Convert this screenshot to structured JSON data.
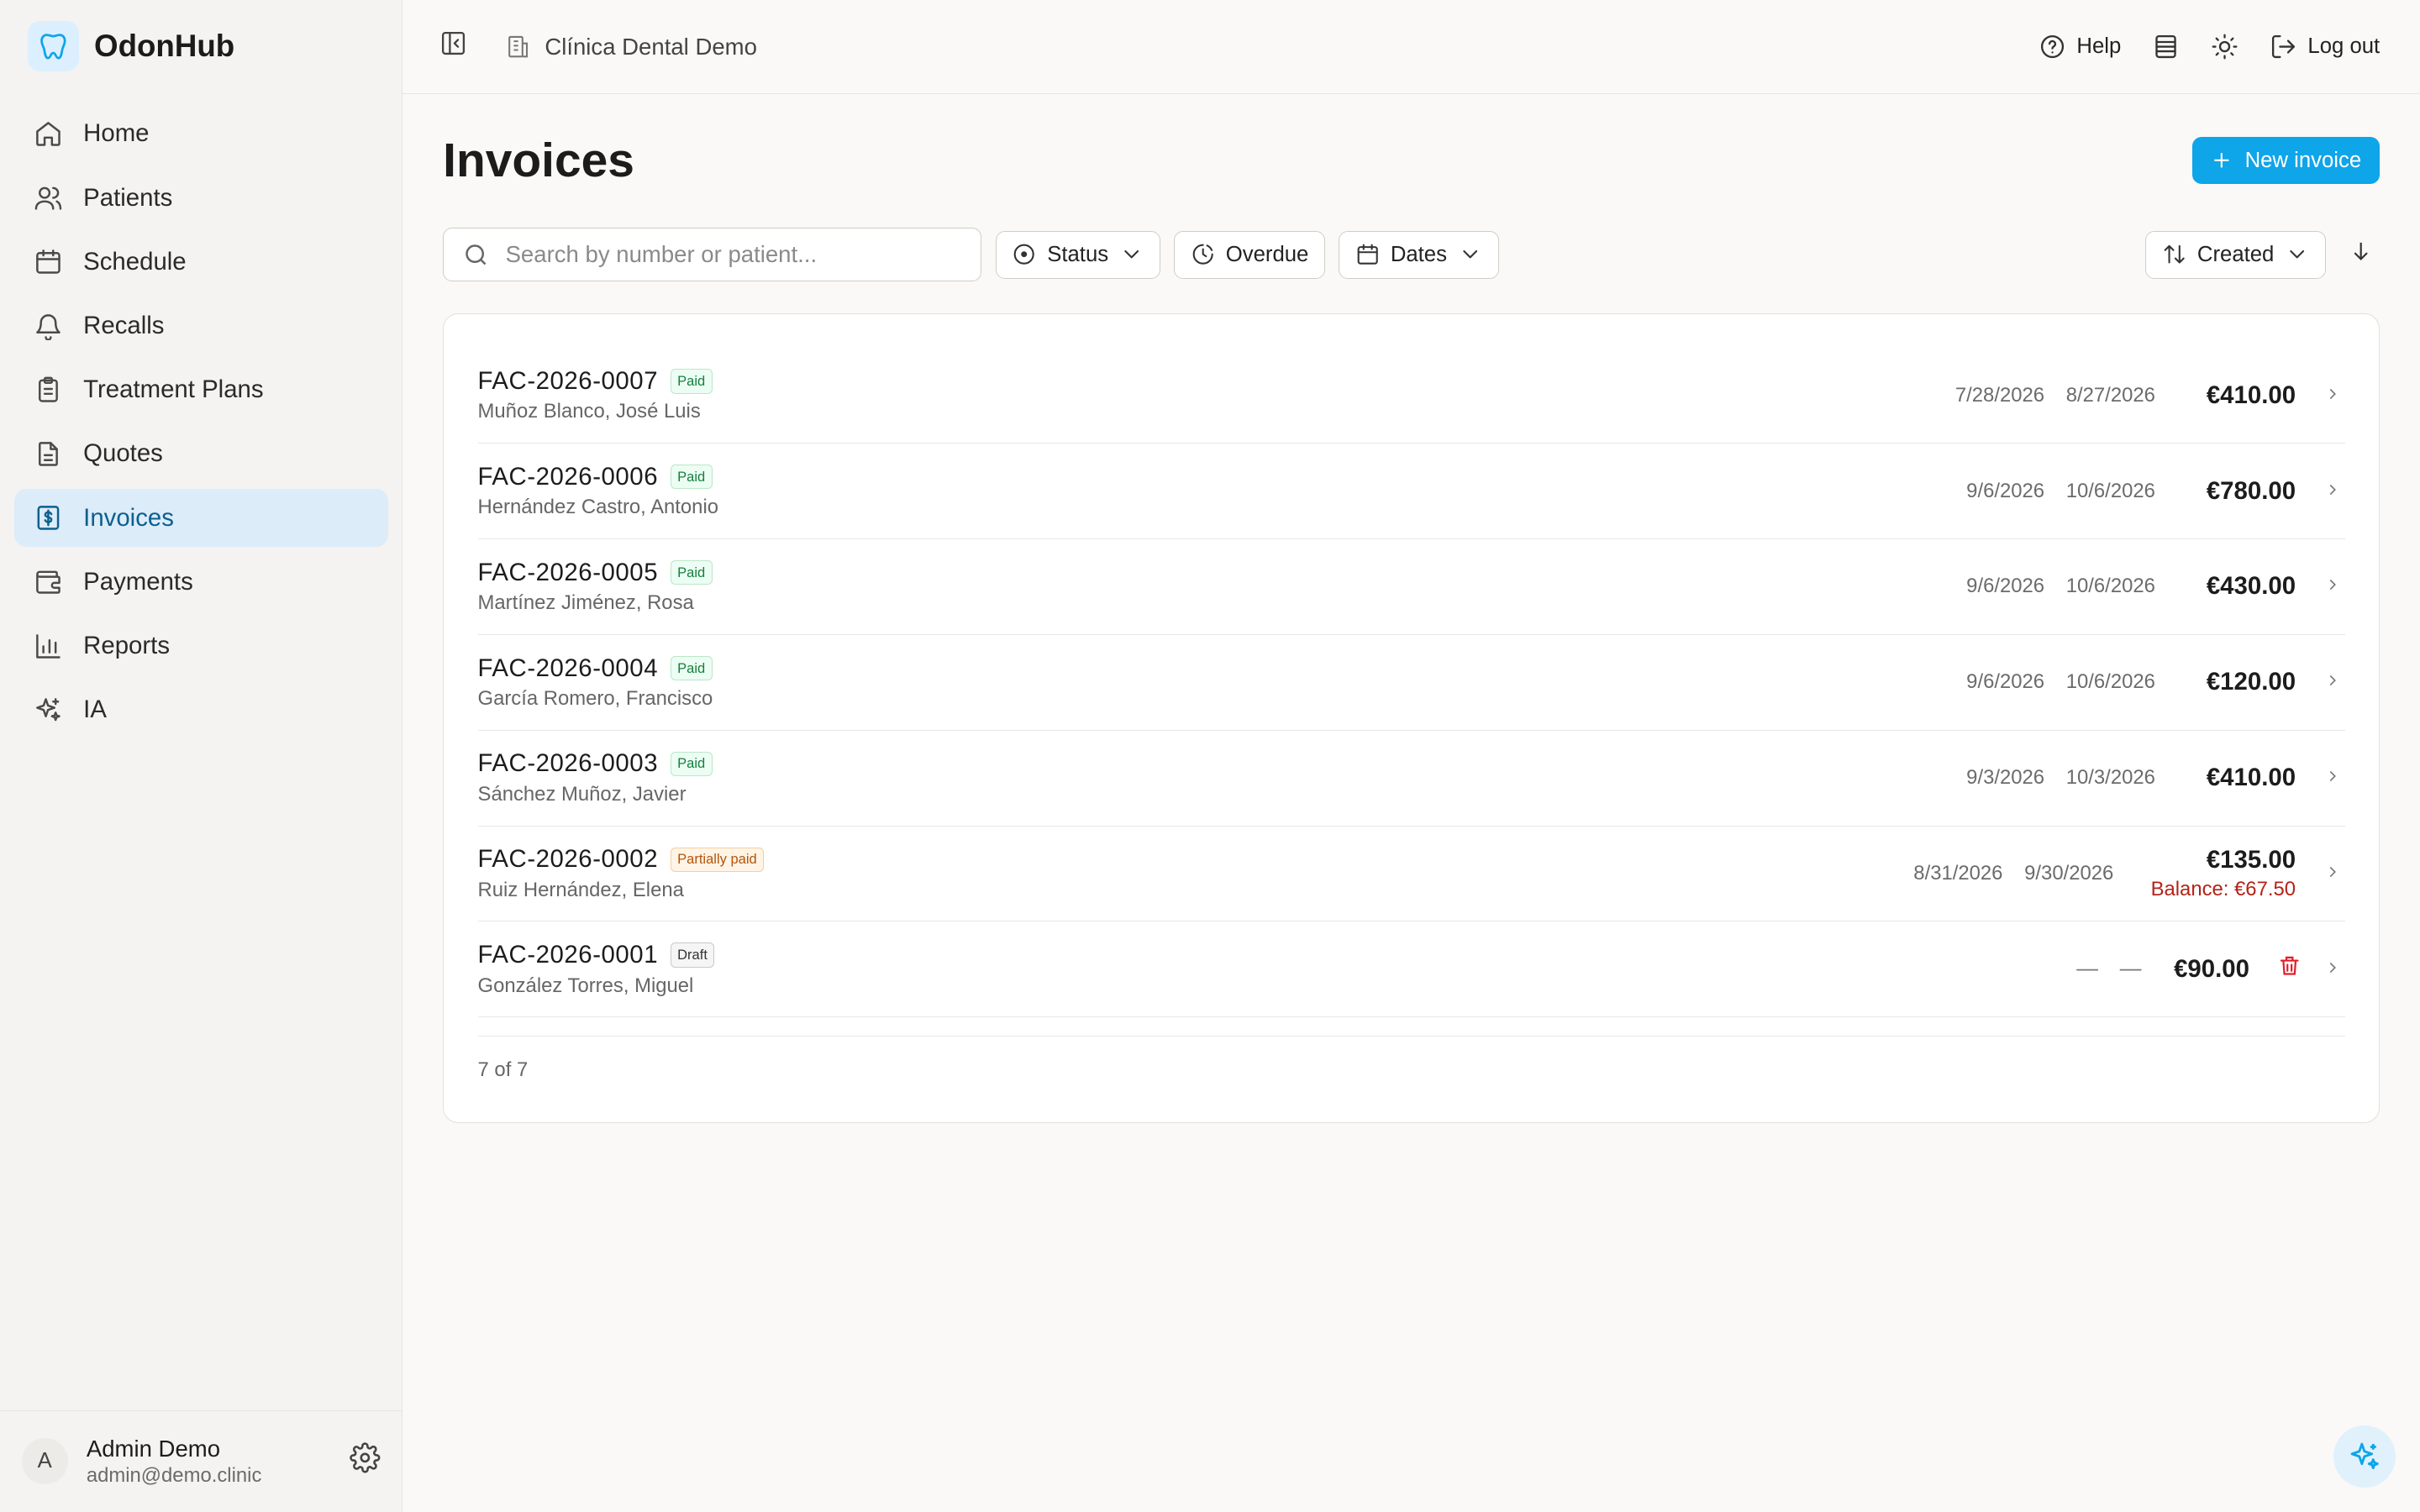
{
  "brand": {
    "name": "OdonHub"
  },
  "sidebar": {
    "items": [
      {
        "label": "Home",
        "icon": "home-icon"
      },
      {
        "label": "Patients",
        "icon": "users-icon"
      },
      {
        "label": "Schedule",
        "icon": "calendar-icon"
      },
      {
        "label": "Recalls",
        "icon": "bell-icon"
      },
      {
        "label": "Treatment Plans",
        "icon": "clipboard-icon"
      },
      {
        "label": "Quotes",
        "icon": "document-icon"
      },
      {
        "label": "Invoices",
        "icon": "invoice-icon",
        "active": true
      },
      {
        "label": "Payments",
        "icon": "wallet-icon"
      },
      {
        "label": "Reports",
        "icon": "bar-chart-icon"
      },
      {
        "label": "IA",
        "icon": "sparkles-icon"
      }
    ]
  },
  "user": {
    "initial": "A",
    "name": "Admin Demo",
    "email": "admin@demo.clinic"
  },
  "topbar": {
    "clinic": "Clínica Dental Demo",
    "help_label": "Help",
    "logout_label": "Log out"
  },
  "page": {
    "title": "Invoices",
    "new_invoice_label": "New invoice"
  },
  "filters": {
    "search_placeholder": "Search by number or patient...",
    "status_label": "Status",
    "overdue_label": "Overdue",
    "dates_label": "Dates",
    "sort_label": "Created"
  },
  "invoices": [
    {
      "number": "FAC-2026-0007",
      "status": "Paid",
      "patient": "Muñoz Blanco, José Luis",
      "date1": "7/28/2026",
      "date2": "8/27/2026",
      "amount": "€410.00"
    },
    {
      "number": "FAC-2026-0006",
      "status": "Paid",
      "patient": "Hernández Castro, Antonio",
      "date1": "9/6/2026",
      "date2": "10/6/2026",
      "amount": "€780.00"
    },
    {
      "number": "FAC-2026-0005",
      "status": "Paid",
      "patient": "Martínez Jiménez, Rosa",
      "date1": "9/6/2026",
      "date2": "10/6/2026",
      "amount": "€430.00"
    },
    {
      "number": "FAC-2026-0004",
      "status": "Paid",
      "patient": "García Romero, Francisco",
      "date1": "9/6/2026",
      "date2": "10/6/2026",
      "amount": "€120.00"
    },
    {
      "number": "FAC-2026-0003",
      "status": "Paid",
      "patient": "Sánchez Muñoz, Javier",
      "date1": "9/3/2026",
      "date2": "10/3/2026",
      "amount": "€410.00"
    },
    {
      "number": "FAC-2026-0002",
      "status": "Partially paid",
      "patient": "Ruiz Hernández, Elena",
      "date1": "8/31/2026",
      "date2": "9/30/2026",
      "amount": "€135.00",
      "balance": "Balance: €67.50"
    },
    {
      "number": "FAC-2026-0001",
      "status": "Draft",
      "patient": "González Torres, Miguel",
      "date1": "—",
      "date2": "—",
      "amount": "€90.00"
    }
  ],
  "count_text": "7 of 7",
  "colors": {
    "accent": "#0ea5e9",
    "active_nav_bg": "#dcecf9",
    "danger": "#e11d2a"
  }
}
